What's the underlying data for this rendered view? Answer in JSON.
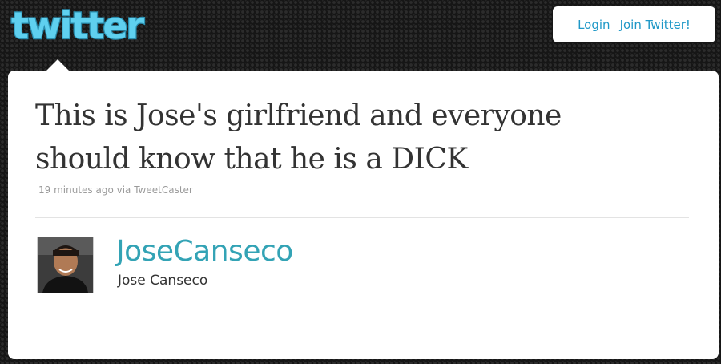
{
  "header": {
    "logo_text": "twitter",
    "login_label": "Login",
    "join_label": "Join Twitter!"
  },
  "tweet": {
    "text": "This is Jose's girlfriend and everyone should know that he is a DICK",
    "meta": "19 minutes ago via TweetCaster"
  },
  "author": {
    "screen_name": "JoseCanseco",
    "full_name": "Jose Canseco"
  },
  "colors": {
    "logo_fill": "#5fd0ef",
    "link": "#1f98c7",
    "screen_name": "#33a3b5",
    "background": "#161616"
  }
}
